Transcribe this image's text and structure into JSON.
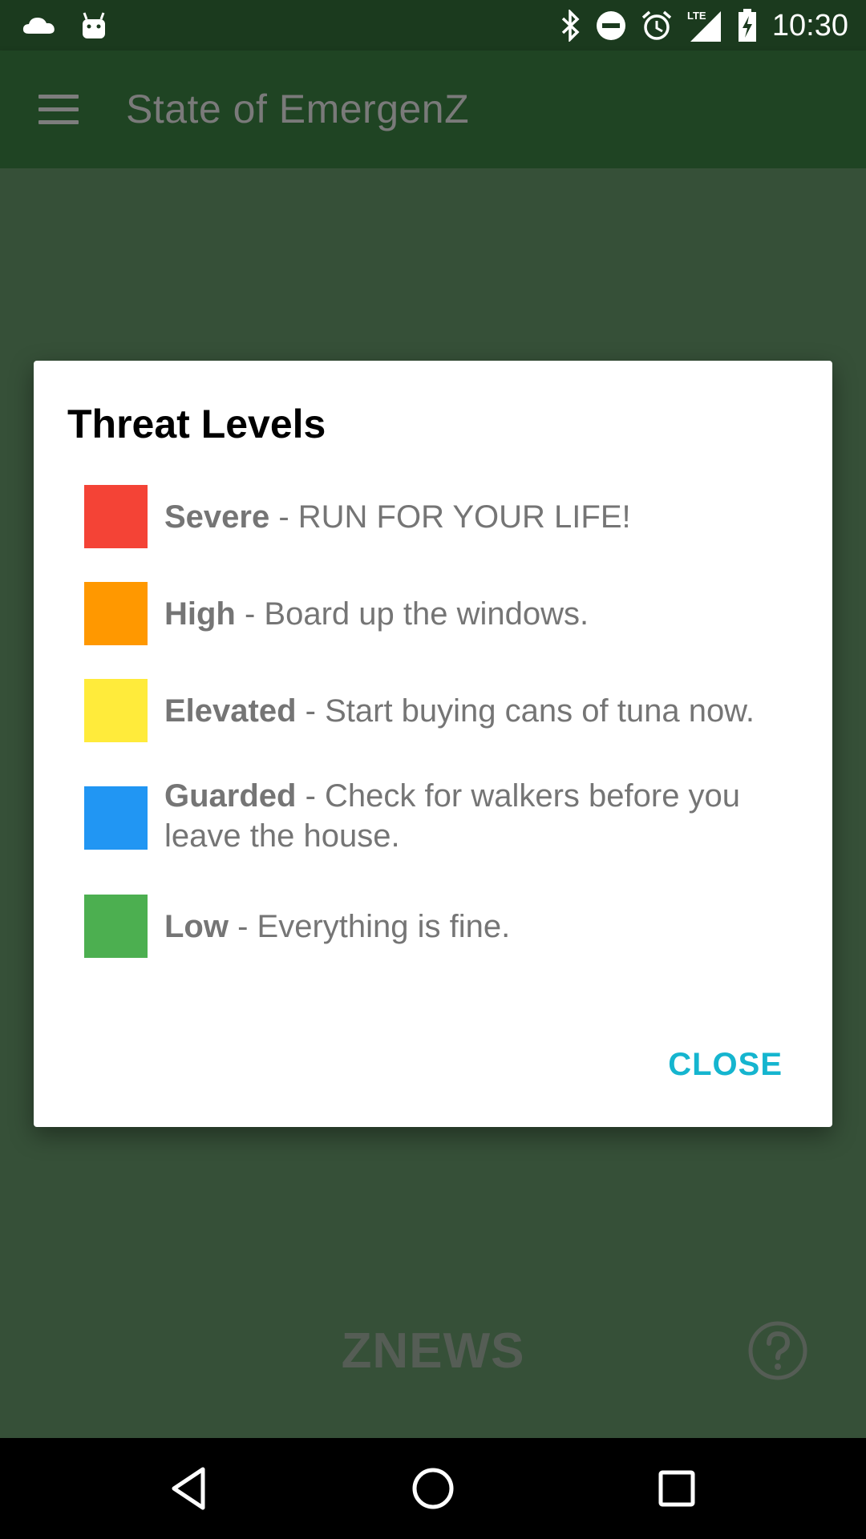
{
  "status_bar": {
    "time": "10:30",
    "icons": [
      "cloud-icon",
      "android-icon",
      "bluetooth-icon",
      "do-not-disturb-icon",
      "alarm-icon",
      "lte-signal-icon",
      "battery-charging-icon"
    ],
    "network_label": "LTE"
  },
  "app_bar": {
    "title": "State of EmergenZ",
    "menu_icon": "hamburger-menu-icon"
  },
  "background": {
    "brand": "ZNEWS",
    "help_icon": "question-circle-icon"
  },
  "dialog": {
    "title": "Threat Levels",
    "levels": [
      {
        "name": "Severe",
        "description": " - RUN FOR YOUR LIFE!",
        "color": "#f44336"
      },
      {
        "name": "High",
        "description": " - Board up the windows.",
        "color": "#ff9800"
      },
      {
        "name": "Elevated",
        "description": " - Start buying cans of tuna now.",
        "color": "#ffeb3b"
      },
      {
        "name": "Guarded",
        "description": " - Check for walkers before you leave the house.",
        "color": "#2196f3"
      },
      {
        "name": "Low",
        "description": " - Everything is fine.",
        "color": "#4caf50"
      }
    ],
    "close_label": "CLOSE",
    "accent_color": "#15b5cf"
  },
  "nav_bar": {
    "buttons": [
      "back-icon",
      "home-icon",
      "recents-icon"
    ]
  }
}
